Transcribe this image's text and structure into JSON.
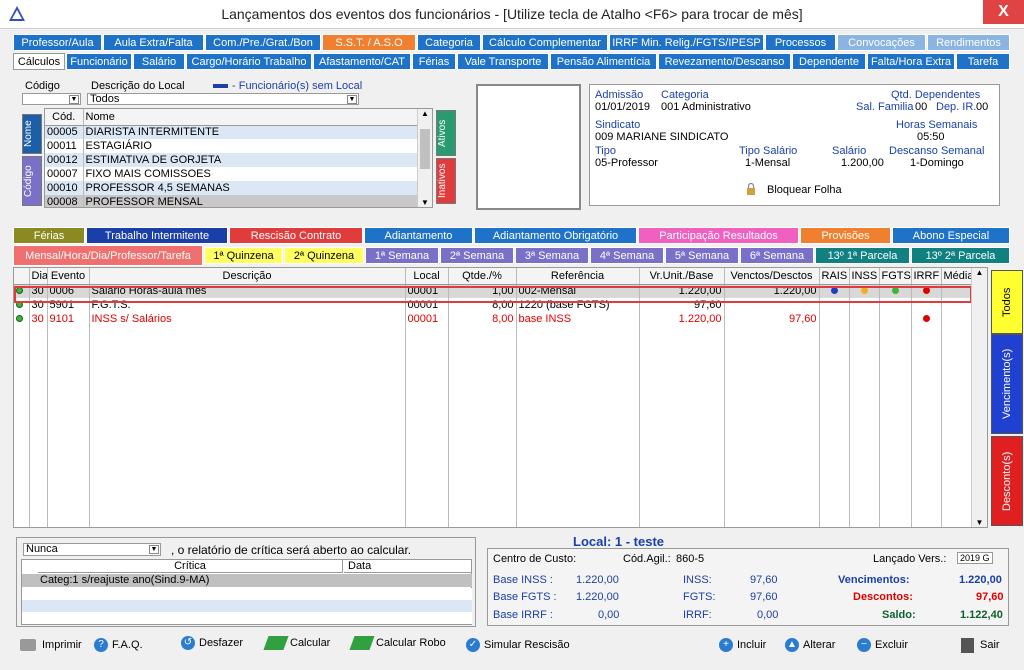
{
  "window": {
    "title": "Lançamentos dos eventos dos funcionários - [Utilize tecla de Atalho <F6> para trocar de mês]",
    "close": "X"
  },
  "tabs_row1": [
    {
      "label": "Professor/Aula",
      "bg": "#1e73c8"
    },
    {
      "label": "Aula Extra/Falta",
      "bg": "#1e73c8"
    },
    {
      "label": "Com./Pre./Grat./Bon",
      "bg": "#1e73c8"
    },
    {
      "label": "S.S.T. / A.S.O",
      "bg": "#f08030"
    },
    {
      "label": "Categoria",
      "bg": "#1e73c8"
    },
    {
      "label": "Cálculo Complementar",
      "bg": "#1e73c8"
    },
    {
      "label": "IRRF Min. Relig./FGTS/IPESP",
      "bg": "#1e73c8"
    },
    {
      "label": "Processos",
      "bg": "#1e73c8"
    },
    {
      "label": "Convocações",
      "bg": "#8bb5e0"
    },
    {
      "label": "Rendimentos",
      "bg": "#8bb5e0"
    }
  ],
  "tabs_row2": [
    {
      "label": "Cálculos"
    },
    {
      "label": "Funcionário"
    },
    {
      "label": "Salário"
    },
    {
      "label": "Cargo/Horário Trabalho"
    },
    {
      "label": "Afastamento/CAT"
    },
    {
      "label": "Férias"
    },
    {
      "label": "Vale Transporte"
    },
    {
      "label": "Pensão Alimentícia"
    },
    {
      "label": "Revezamento/Descanso"
    },
    {
      "label": "Dependente"
    },
    {
      "label": "Falta/Hora Extra"
    },
    {
      "label": "Tarefa"
    }
  ],
  "filter": {
    "codigo_label": "Código",
    "descricao_label": "Descrição do Local",
    "legend": "- Funcionário(s) sem Local",
    "select_value": "Todos"
  },
  "emp_list": {
    "col_cod": "Cód.",
    "col_nome": "Nome",
    "rows": [
      {
        "cod": "00005",
        "nome": "DIARISTA INTERMITENTE"
      },
      {
        "cod": "00011",
        "nome": "ESTAGIÁRIO"
      },
      {
        "cod": "00012",
        "nome": "ESTIMATIVA DE GORJETA"
      },
      {
        "cod": "00007",
        "nome": "FIXO MAIS COMISSOES"
      },
      {
        "cod": "00010",
        "nome": "PROFESSOR 4,5 SEMANAS"
      },
      {
        "cod": "00008",
        "nome": "PROFESSOR MENSAL"
      }
    ],
    "side_nome": "Nome",
    "side_codigo": "Código",
    "side_ativos": "Ativos",
    "side_inativos": "Inativos"
  },
  "info": {
    "admissao_label": "Admissão",
    "admissao": "01/01/2019",
    "categoria_label": "Categoria",
    "categoria": "001  Administrativo",
    "qtd_dep_label": "Qtd. Dependentes",
    "sal_familia_label": "Sal. Familia",
    "sal_familia": "00",
    "dep_ir_label": "Dep. IR.",
    "dep_ir": "00",
    "sindicato_label": "Sindicato",
    "sindicato": "009  MARIANE SINDICATO",
    "horas_label": "Horas Semanais",
    "horas": "05:50",
    "tipo_label": "Tipo",
    "tipo": "05-Professor",
    "tipo_sal_label": "Tipo Salário",
    "tipo_sal": "1-Mensal",
    "salario_label": "Salário",
    "salario": "1.200,00",
    "descanso_label": "Descanso Semanal",
    "descanso": "1-Domingo",
    "bloquear": "Bloquear Folha"
  },
  "tabs_row3": [
    {
      "label": "Férias",
      "bg": "#8a8a20"
    },
    {
      "label": "Trabalho Intermitente",
      "bg": "#1a3fa8"
    },
    {
      "label": "Rescisão Contrato",
      "bg": "#e03c3c"
    },
    {
      "label": "Adiantamento",
      "bg": "#1e73c8"
    },
    {
      "label": "Adiantamento Obrigatório",
      "bg": "#1e73c8"
    },
    {
      "label": "Participação Resultados",
      "bg": "#f060c0"
    },
    {
      "label": "Provisões",
      "bg": "#f08030"
    },
    {
      "label": "Abono Especial",
      "bg": "#1e73c8"
    }
  ],
  "tabs_row4": [
    {
      "label": "Mensal/Hora/Dia/Professor/Tarefa",
      "bg": "#f07070"
    },
    {
      "label": "1ª Quinzena",
      "bg": "#ffff60"
    },
    {
      "label": "2ª Quinzena",
      "bg": "#ffff60"
    },
    {
      "label": "1ª Semana",
      "bg": "#7a70c8"
    },
    {
      "label": "2ª Semana",
      "bg": "#7a70c8"
    },
    {
      "label": "3ª Semana",
      "bg": "#7a70c8"
    },
    {
      "label": "4ª Semana",
      "bg": "#7a70c8"
    },
    {
      "label": "5ª Semana",
      "bg": "#7a70c8"
    },
    {
      "label": "6ª Semana",
      "bg": "#7a70c8"
    },
    {
      "label": "13º  1ª Parcela",
      "bg": "#108080"
    },
    {
      "label": "13º  2ª  Parcela",
      "bg": "#108080"
    }
  ],
  "events": {
    "headers": [
      "Dia",
      "Evento",
      "Descrição",
      "Local",
      "Qtde./%",
      "Referência",
      "Vr.Unit./Base",
      "Venctos/Desctos",
      "RAIS",
      "INSS",
      "FGTS",
      "IRRF",
      "Média"
    ],
    "rows": [
      {
        "dia": "30",
        "evento": "0006",
        "desc": "Salario Horas-aula mês",
        "local": "00001",
        "qtde": "1,00",
        "ref": "002-Mensal",
        "vr": "1.220,00",
        "vd": "1.220,00",
        "red": false
      },
      {
        "dia": "30",
        "evento": "5901",
        "desc": "F.G.T.S.",
        "local": "00001",
        "qtde": "8,00",
        "ref": "1220 (base FGTS)",
        "vr": "97,60",
        "vd": "",
        "red": false
      },
      {
        "dia": "30",
        "evento": "9101",
        "desc": "INSS s/ Salários",
        "local": "00001",
        "qtde": "8,00",
        "ref": "base INSS",
        "vr": "1.220,00",
        "vd": "97,60",
        "red": true
      }
    ]
  },
  "vtabs": {
    "todos": "Todos",
    "venc": "Vencimento(s)",
    "desc": "Desconto(s)"
  },
  "critica": {
    "select": "Nunca",
    "text": ", o relatório de crítica será aberto ao calcular.",
    "col1": "Crítica",
    "col2": "Data",
    "row": "Categ:1 s/reajuste ano(Sind.9-MA)"
  },
  "summary": {
    "local": "Local: 1 - teste",
    "centro": "Centro de Custo:",
    "cod_agil_label": "Cód.Agil.:",
    "cod_agil": "860-5",
    "lancado_label": "Lançado Vers.:",
    "lancado": "2019 G",
    "base_inss_label": "Base  INSS :",
    "base_inss": "1.220,00",
    "inss_label": "INSS:",
    "inss": "97,60",
    "venc_label": "Vencimentos:",
    "venc": "1.220,00",
    "base_fgts_label": "Base FGTS :",
    "base_fgts": "1.220,00",
    "fgts_label": "FGTS:",
    "fgts": "97,60",
    "desc_label": "Descontos:",
    "desc": "97,60",
    "base_irrf_label": "Base  IRRF :",
    "base_irrf": "0,00",
    "irrf_label": "IRRF:",
    "irrf": "0,00",
    "saldo_label": "Saldo:",
    "saldo": "1.122,40"
  },
  "buttons": {
    "imprimir": "Imprimir",
    "faq": "F.A.Q.",
    "desfazer": "Desfazer",
    "calcular": "Calcular",
    "calcular_robo": "Calcular Robo",
    "simular": "Simular Rescisão",
    "incluir": "Incluir",
    "alterar": "Alterar",
    "excluir": "Excluir",
    "sair": "Sair"
  }
}
